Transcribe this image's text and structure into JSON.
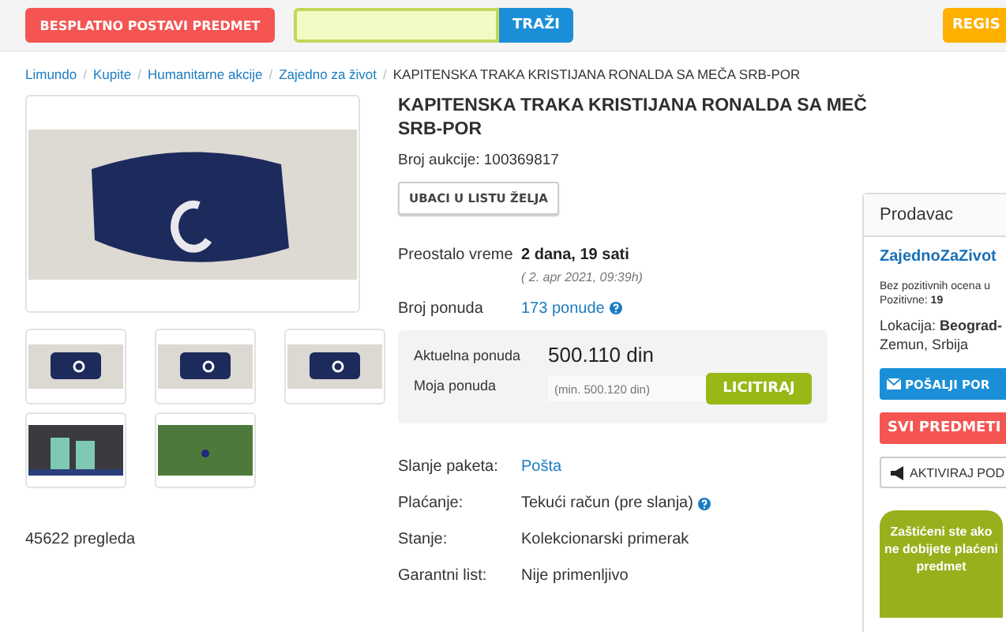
{
  "header": {
    "post_button": "BESPLATNO POSTAVI PREDMET",
    "search_button": "TRAŽI",
    "register_button": "REGIS"
  },
  "breadcrumb_separator": "/",
  "breadcrumb": [
    {
      "label": "Limundo",
      "kind": "link"
    },
    {
      "label": "Kupite",
      "kind": "link"
    },
    {
      "label": "Humanitarne akcije",
      "kind": "link"
    },
    {
      "label": "Zajedno za život",
      "kind": "link"
    },
    {
      "label": "KAPITENSKA TRAKA KRISTIJANA RONALDA SA MEČA SRB-POR",
      "kind": "current"
    }
  ],
  "gallery": {
    "thumbnails": [
      {
        "kind": "armband"
      },
      {
        "kind": "armband"
      },
      {
        "kind": "armband"
      },
      {
        "kind": "players"
      },
      {
        "kind": "pitch"
      }
    ],
    "views": "45622 pregleda"
  },
  "item": {
    "title_lines": [
      "KAPITENSKA TRAKA KRISTIJANA RONALDA SA MEČ",
      "SRB-POR"
    ],
    "auction_number": "Broj aukcije: 100369817",
    "wishlist_button": "UBACI U LISTU ŽELJA",
    "time_label": "Preostalo vreme",
    "time_value": "2 dana, 19 sati",
    "end_date": "( 2. apr 2021, 09:39h)",
    "bids_label": "Broj ponuda",
    "bids_value": "173 ponude",
    "current_bid_label": "Aktuelna ponuda",
    "current_bid": "500.110 din",
    "my_bid_label": "Moja ponuda",
    "my_bid_placeholder": "(min. 500.120 din)",
    "bid_button": "LICITIRAJ",
    "details": [
      {
        "label": "Slanje paketa:",
        "value": "Pošta",
        "kind": "link"
      },
      {
        "label": "Plaćanje:",
        "value": "Tekući račun (pre slanja)",
        "kind": "help"
      },
      {
        "label": "Stanje:",
        "value": "Kolekcionarski primerak",
        "kind": "text"
      },
      {
        "label": "Garantni list:",
        "value": "Nije primenljivo",
        "kind": "text"
      }
    ]
  },
  "seller": {
    "heading": "Prodavac",
    "name": "ZajednoZaZivot",
    "rating": "Bez pozitivnih ocena u",
    "positive": "Pozitivne: **19**",
    "location": "Lokacija: **Beograd-**",
    "location_2": "Zemun, Srbija",
    "message_button": "POŠALJI POR",
    "all_items_button": "SVI PREDMETI",
    "promote_button": "AKTIVIRAJ POD",
    "badge": "Zaštićeni ste ako ne dobijete plaćeni predmet"
  }
}
